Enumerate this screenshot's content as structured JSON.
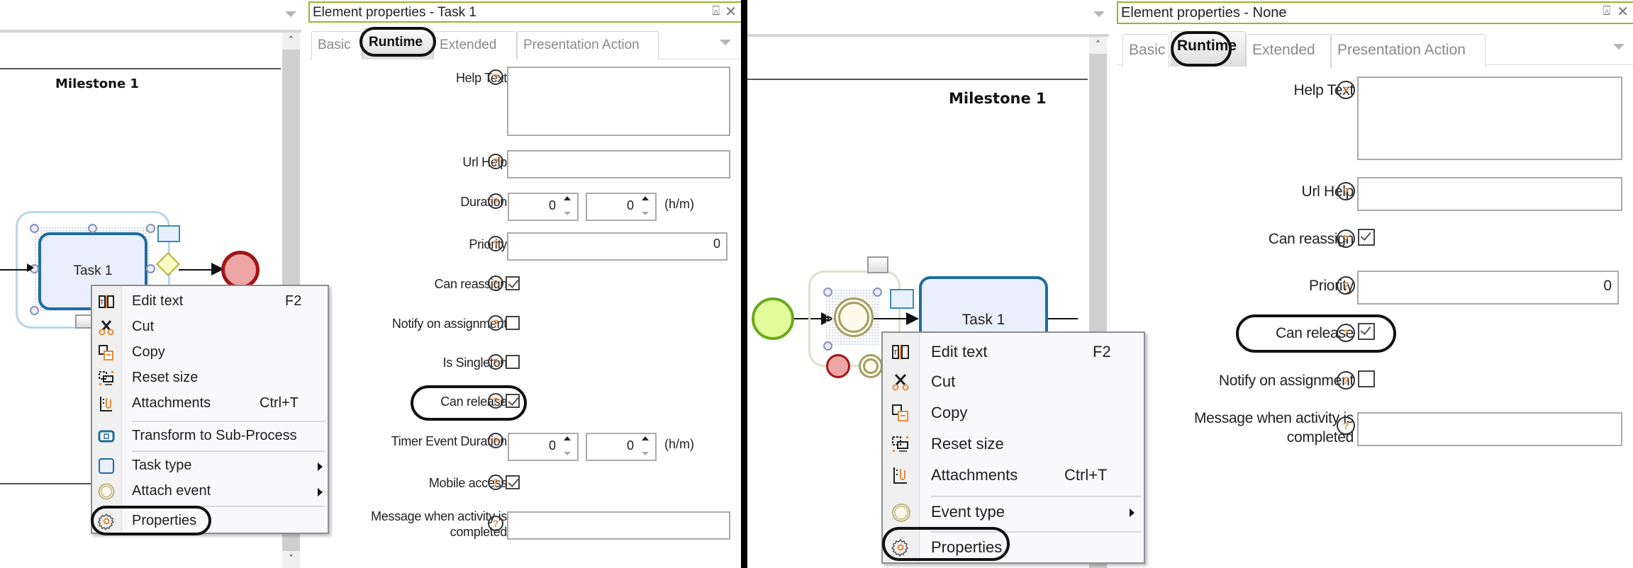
{
  "left": {
    "canvas": {
      "milestone": "Milestone 1",
      "task_label": "Task 1",
      "scroll_up": "^",
      "scroll_down": "v"
    },
    "context_menu": {
      "items": [
        {
          "label": "Edit text",
          "shortcut": "F2",
          "icon": "edit-text-icon"
        },
        {
          "label": "Cut",
          "shortcut": "",
          "icon": "scissors-icon"
        },
        {
          "label": "Copy",
          "shortcut": "",
          "icon": "copy-icon"
        },
        {
          "label": "Reset size",
          "shortcut": "",
          "icon": "reset-size-icon"
        },
        {
          "label": "Attachments",
          "shortcut": "Ctrl+T",
          "icon": "attachment-icon"
        },
        {
          "label": "Transform to Sub-Process",
          "shortcut": "",
          "icon": "subprocess-icon"
        },
        {
          "label": "Task type",
          "shortcut": "",
          "icon": "task-type-icon",
          "submenu": true
        },
        {
          "label": "Attach event",
          "shortcut": "",
          "icon": "event-icon",
          "submenu": true
        },
        {
          "label": "Properties",
          "shortcut": "",
          "icon": "gear-icon",
          "highlighted": true
        }
      ]
    },
    "properties": {
      "title": "Element properties - Task 1",
      "pin": "⍓",
      "close": "✕",
      "tabs": [
        "Basic",
        "Runtime",
        "Extended",
        "Presentation Action"
      ],
      "active_tab": "Runtime",
      "help_glyph": "?",
      "fields": {
        "help_text": {
          "label": "Help Text",
          "value": ""
        },
        "url_help": {
          "label": "Url Help",
          "value": ""
        },
        "duration": {
          "label": "Duration",
          "hours": "0",
          "minutes": "0",
          "unit": "(h/m)"
        },
        "priority": {
          "label": "Priority",
          "value": "0"
        },
        "can_reassign": {
          "label": "Can reassign",
          "checked": true
        },
        "notify_on_assignment": {
          "label": "Notify on assignment",
          "checked": false
        },
        "is_singleton": {
          "label": "Is Singleton",
          "checked": false
        },
        "can_release": {
          "label": "Can release",
          "checked": true,
          "highlighted": true
        },
        "timer_event_duration": {
          "label": "Timer Event Duration",
          "hours": "0",
          "minutes": "0",
          "unit": "(h/m)"
        },
        "mobile_access": {
          "label": "Mobile access",
          "checked": true
        },
        "message_completed": {
          "label": "Message when activity is completed",
          "value": ""
        }
      }
    }
  },
  "right": {
    "canvas": {
      "milestone": "Milestone 1",
      "task_label": "Task 1",
      "scroll_up": "^"
    },
    "context_menu": {
      "items": [
        {
          "label": "Edit text",
          "shortcut": "F2",
          "icon": "edit-text-icon"
        },
        {
          "label": "Cut",
          "shortcut": "",
          "icon": "scissors-icon"
        },
        {
          "label": "Copy",
          "shortcut": "",
          "icon": "copy-icon"
        },
        {
          "label": "Reset size",
          "shortcut": "",
          "icon": "reset-size-icon"
        },
        {
          "label": "Attachments",
          "shortcut": "Ctrl+T",
          "icon": "attachment-icon"
        },
        {
          "label": "Event type",
          "shortcut": "",
          "icon": "event-icon",
          "submenu": true
        },
        {
          "label": "Properties",
          "shortcut": "",
          "icon": "gear-icon",
          "highlighted": true
        }
      ]
    },
    "properties": {
      "title": "Element properties - None",
      "pin": "⍓",
      "close": "✕",
      "tabs": [
        "Basic",
        "Runtime",
        "Extended",
        "Presentation Action"
      ],
      "active_tab": "Runtime",
      "help_glyph": "?",
      "fields": {
        "help_text": {
          "label": "Help Text",
          "value": ""
        },
        "url_help": {
          "label": "Url Help",
          "value": ""
        },
        "can_reassign": {
          "label": "Can reassign",
          "checked": true
        },
        "priority": {
          "label": "Priority",
          "value": "0"
        },
        "can_release": {
          "label": "Can release",
          "checked": true,
          "highlighted": true
        },
        "notify_on_assignment": {
          "label": "Notify on assignment",
          "checked": false
        },
        "message_completed": {
          "label": "Message when activity is completed",
          "value": ""
        }
      }
    }
  },
  "colors": {
    "panel_header_border": "#9ab42f",
    "task_border": "#1e6d9e",
    "task_fill": "#e9effc",
    "end_event": "#a31515",
    "start_event": "#6aaa1a",
    "help_icon": "#e8893a",
    "icon_accent": "#e8893a"
  }
}
